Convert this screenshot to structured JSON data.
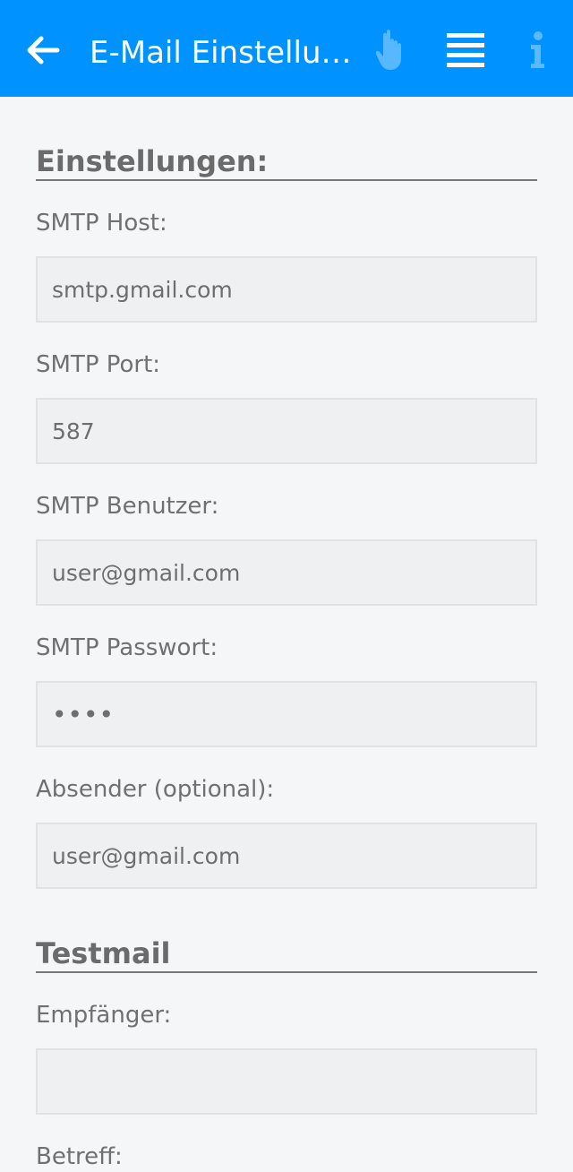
{
  "header": {
    "title": "E-Mail Einstellungen",
    "back_icon": "arrow-left-icon",
    "actions": [
      {
        "icon": "touch-hand-icon"
      },
      {
        "icon": "list-lines-icon"
      },
      {
        "icon": "info-icon"
      }
    ],
    "colors": {
      "bar": "#0093ff",
      "icon_light": "#5cb8ff"
    }
  },
  "settings": {
    "heading": "Einstellungen:",
    "smtp_host": {
      "label": "SMTP Host:",
      "value": "smtp.gmail.com"
    },
    "smtp_port": {
      "label": "SMTP Port:",
      "value": "587"
    },
    "smtp_user": {
      "label": "SMTP Benutzer:",
      "value": "user@gmail.com"
    },
    "smtp_password": {
      "label": "SMTP Passwort:",
      "value": "••••"
    },
    "sender": {
      "label": "Absender (optional):",
      "value": "user@gmail.com"
    }
  },
  "testmail": {
    "heading": "Testmail",
    "recipient": {
      "label": "Empfänger:",
      "value": ""
    },
    "subject": {
      "label": "Betreff:"
    }
  }
}
